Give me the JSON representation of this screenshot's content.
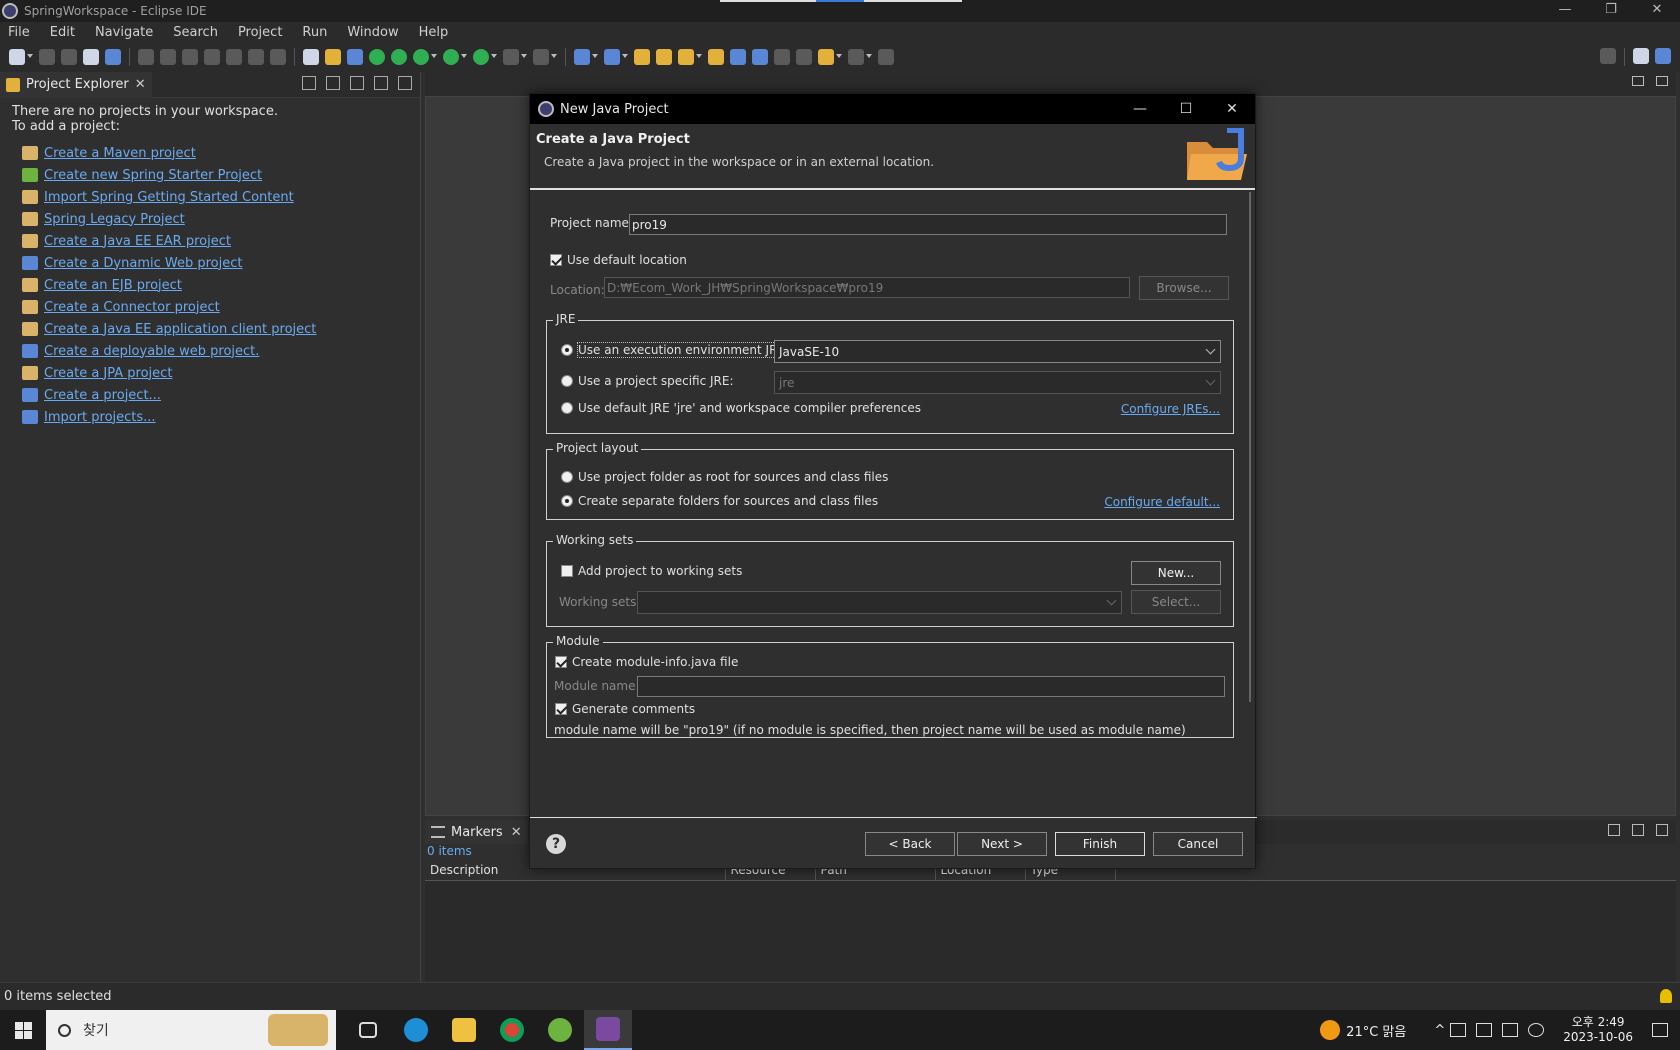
{
  "window": {
    "title": "SpringWorkspace - Eclipse IDE"
  },
  "menu": [
    "File",
    "Edit",
    "Navigate",
    "Search",
    "Project",
    "Run",
    "Window",
    "Help"
  ],
  "explorer": {
    "tab_label": "Project Explorer",
    "empty_line1": "There are no projects in your workspace.",
    "empty_line2": "To add a project:",
    "links": [
      "Create a Maven project",
      "Create new Spring Starter Project",
      "Import Spring Getting Started Content",
      "Spring Legacy Project",
      "Create a Java EE EAR project",
      "Create a Dynamic Web project",
      "Create an EJB project",
      "Create a Connector project",
      "Create a Java EE application client project",
      "Create a deployable web project.",
      "Create a JPA project",
      "Create a project...",
      "Import projects..."
    ]
  },
  "status": {
    "text": "0 items selected"
  },
  "markers": {
    "tab_label": "Markers",
    "count": "0 items",
    "columns": [
      "Description",
      "Resource",
      "Path",
      "Location",
      "Type"
    ]
  },
  "dialog": {
    "title": "New Java Project",
    "heading": "Create a Java Project",
    "subheading": "Create a Java project in the workspace or in an external location.",
    "project_name_label": "Project name:",
    "project_name_value": "pro19",
    "use_default_location": "Use default location",
    "location_label": "Location:",
    "location_value": "D:₩Ecom_Work_JH₩SpringWorkspace₩pro19",
    "browse": "Browse...",
    "jre_group": "JRE",
    "jre_exec_env": "Use an execution environment JRE:",
    "jre_exec_env_value": "JavaSE-10",
    "jre_project_specific": "Use a project specific JRE:",
    "jre_project_specific_value": "jre",
    "jre_default": "Use default JRE 'jre' and workspace compiler preferences",
    "configure_jres": "Configure JREs...",
    "layout_group": "Project layout",
    "layout_root": "Use project folder as root for sources and class files",
    "layout_separate": "Create separate folders for sources and class files",
    "configure_default": "Configure default...",
    "ws_group": "Working sets",
    "ws_add": "Add project to working sets",
    "ws_new": "New...",
    "ws_label": "Working sets:",
    "ws_select": "Select...",
    "module_group": "Module",
    "module_create": "Create module-info.java file",
    "module_name_label": "Module name:",
    "module_name_value": "",
    "module_comments": "Generate comments",
    "module_note": "module name will be \"pro19\"  (if no module is specified, then project name will be used as module name)",
    "btn_back": "< Back",
    "btn_next": "Next >",
    "btn_finish": "Finish",
    "btn_cancel": "Cancel",
    "help": "?"
  },
  "taskbar": {
    "search_placeholder": "찾기",
    "weather": "21°C  맑음",
    "time": "오후 2:49",
    "date": "2023-10-06"
  }
}
